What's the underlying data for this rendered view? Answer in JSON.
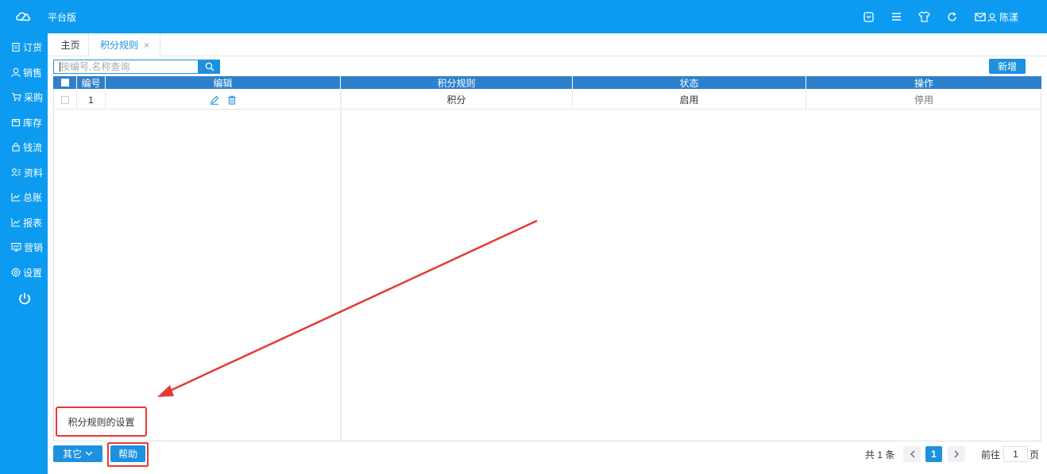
{
  "header": {
    "title": "平台版",
    "user_name": "陈漾",
    "icons": [
      "message-box-icon",
      "menu-list-icon",
      "shirt-icon",
      "refresh-icon",
      "mail-icon",
      "user-icon"
    ]
  },
  "sidebar": {
    "items": [
      {
        "label": "订货",
        "icon": "clipboard-icon"
      },
      {
        "label": "销售",
        "icon": "person-icon"
      },
      {
        "label": "采购",
        "icon": "cart-icon"
      },
      {
        "label": "库存",
        "icon": "box-icon"
      },
      {
        "label": "钱流",
        "icon": "lock-bag-icon"
      },
      {
        "label": "资料",
        "icon": "profile-icon"
      },
      {
        "label": "总账",
        "icon": "chart-icon"
      },
      {
        "label": "报表",
        "icon": "chart-icon"
      },
      {
        "label": "营销",
        "icon": "monitor-icon"
      },
      {
        "label": "设置",
        "icon": "gear-icon"
      }
    ]
  },
  "tabs": {
    "home": "主页",
    "active": "积分规则",
    "close": "×"
  },
  "search": {
    "placeholder": "按编号,名称查询",
    "value": ""
  },
  "toolbar": {
    "add_label": "新增"
  },
  "table": {
    "columns": {
      "index": "编号",
      "edit": "编辑",
      "rule": "积分规则",
      "status": "状态",
      "action": "操作"
    },
    "rows": [
      {
        "index": "1",
        "rule": "积分",
        "status": "启用",
        "action": "停用"
      }
    ]
  },
  "tooltip": {
    "text": "积分规则的设置"
  },
  "footer": {
    "other_label": "其它",
    "help_label": "帮助",
    "total": "共 1 条",
    "current_page": "1",
    "goto_label": "前往",
    "goto_value": "1",
    "page_unit": "页"
  },
  "colors": {
    "brand": "#0d9bf2",
    "header_row": "#2e7fcc",
    "button": "#1e90e0",
    "annotation": "#e53935"
  }
}
